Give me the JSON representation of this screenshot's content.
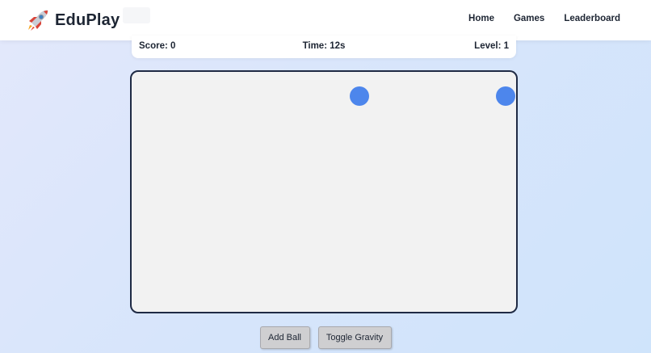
{
  "brand": {
    "name": "EduPlay",
    "logo_icon": "rocket-icon"
  },
  "nav": {
    "items": [
      {
        "label": "Home"
      },
      {
        "label": "Games"
      },
      {
        "label": "Leaderboard"
      }
    ]
  },
  "status": {
    "score": "Score: 0",
    "time": "Time: 12s",
    "level": "Level: 1"
  },
  "game": {
    "ball_color": "#4d86ec",
    "border_color": "#1f2a44",
    "background_color": "#f2f2f2",
    "ball_count": 2
  },
  "controls": {
    "add_ball_label": "Add Ball",
    "toggle_gravity_label": "Toggle Gravity"
  }
}
